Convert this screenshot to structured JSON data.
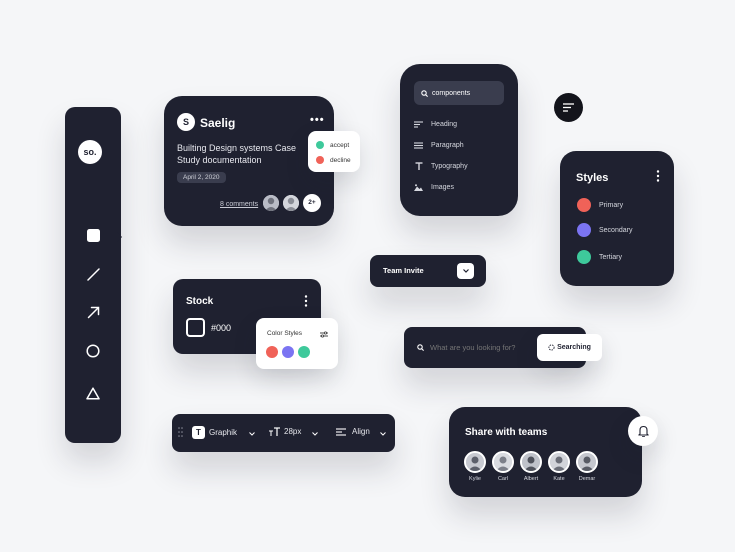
{
  "toolbar": {
    "logo": "so.",
    "tools": [
      "square-icon",
      "line-icon",
      "arrow-icon",
      "circle-icon",
      "triangle-icon"
    ]
  },
  "doc_card": {
    "avatar_letter": "S",
    "name": "Saelig",
    "more": "•••",
    "title": "Builting Design systems Case Study documentation",
    "date": "April 2, 2020",
    "comments": "8 comments",
    "extra_count": "2+"
  },
  "decision_menu": {
    "accept": "accept",
    "decline": "decline",
    "accept_color": "#3ec99b",
    "decline_color": "#f06258"
  },
  "components_menu": {
    "search_value": "components",
    "items": [
      {
        "label": "Heading",
        "icon": "heading-icon"
      },
      {
        "label": "Paragraph",
        "icon": "paragraph-icon"
      },
      {
        "label": "Typography",
        "icon": "typography-icon"
      },
      {
        "label": "Images",
        "icon": "image-icon"
      }
    ]
  },
  "styles": {
    "title": "Styles",
    "items": [
      {
        "label": "Primary",
        "color": "#f06258"
      },
      {
        "label": "Secondary",
        "color": "#7b74f2"
      },
      {
        "label": "Tertiary",
        "color": "#3ec99b"
      }
    ]
  },
  "team_invite": {
    "label": "Team Invite"
  },
  "stock": {
    "title": "Stock",
    "hex": "#000"
  },
  "color_styles": {
    "title": "Color Styles",
    "colors": [
      "#f06258",
      "#7b74f2",
      "#3ec99b"
    ]
  },
  "search": {
    "placeholder": "What are you looking for?",
    "button": "Searching"
  },
  "font_bar": {
    "font": "Graphik",
    "font_icon_letter": "T",
    "size": "28px",
    "align": "Align"
  },
  "share": {
    "title": "Share with teams",
    "members": [
      "Kylie",
      "Carl",
      "Albert",
      "Kate",
      "Demar"
    ]
  },
  "colors": {
    "dark": "#1f2130",
    "background": "#f5f6f8"
  }
}
